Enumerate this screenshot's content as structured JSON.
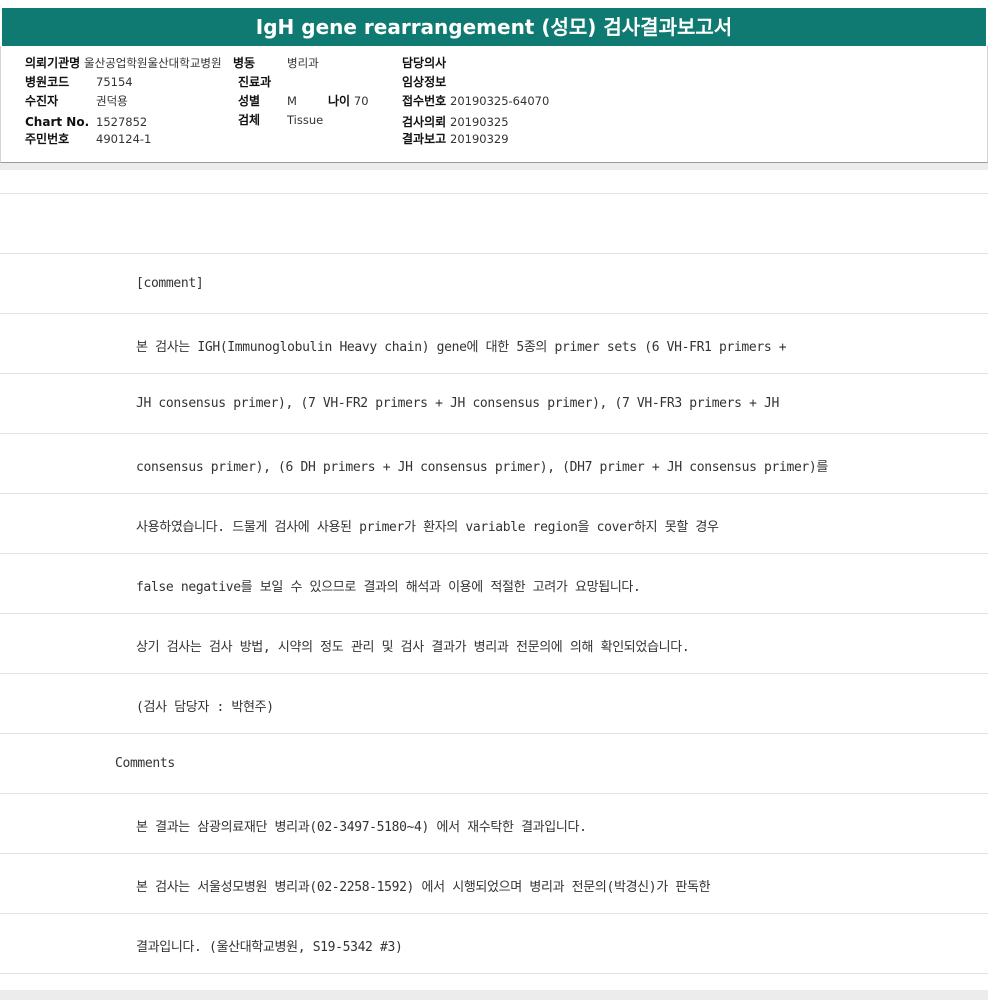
{
  "title": "IgH gene rearrangement (성모) 검사결과보고서",
  "header": {
    "requesting_institution_label": "의뢰기관명",
    "requesting_institution": "울산공업학원울산대학교병원",
    "ward_label": "병동",
    "ward": "병리과",
    "physician_label": "담당의사",
    "physician": "",
    "hospital_code_label": "병원코드",
    "hospital_code": "75154",
    "department_label": "진료과",
    "department": "",
    "clinical_info_label": "임상정보",
    "clinical_info": "",
    "patient_label": "수진자",
    "patient": "권덕용",
    "sex_label": "성별",
    "sex": "M",
    "age_label": "나이",
    "age": "70",
    "receipt_no_label": "접수번호",
    "receipt_no": "20190325-64070",
    "chart_no_label": "Chart No.",
    "chart_no": "1527852",
    "specimen_label": "검체",
    "specimen": "Tissue",
    "request_date_label": "검사의뢰",
    "request_date": "20190325",
    "id_no_label": "주민번호",
    "id_no": "490124-1",
    "report_date_label": "결과보고",
    "report_date": "20190329"
  },
  "report": {
    "lines": [
      "",
      "[comment]",
      "본 검사는 IGH(Immunoglobulin Heavy chain) gene에 대한 5종의 primer sets (6 VH-FR1 primers +",
      "JH consensus primer), (7 VH-FR2 primers + JH consensus primer), (7 VH-FR3 primers + JH",
      "consensus primer), (6 DH primers + JH consensus primer), (DH7 primer + JH consensus primer)를",
      "사용하였습니다. 드물게 검사에 사용된 primer가 환자의 variable region을 cover하지 못할 경우",
      "false negative를 보일 수 있으므로 결과의 해석과 이용에 적절한 고려가 요망됩니다.",
      "상기 검사는 검사 방법, 시약의 정도 관리 및 검사 결과가 병리과 전문의에 의해 확인되었습니다.",
      "(검사 담당자 : 박현주)",
      "Comments",
      "본 결과는 삼광의료재단 병리과(02-3497-5180~4) 에서 재수탁한 결과입니다.",
      "본 검사는 서울성모병원 병리과(02-2258-1592) 에서 시행되었으며 병리과 전문의(박경신)가 판독한",
      "결과입니다. (울산대학교병원, S19-5342 #3)"
    ]
  }
}
